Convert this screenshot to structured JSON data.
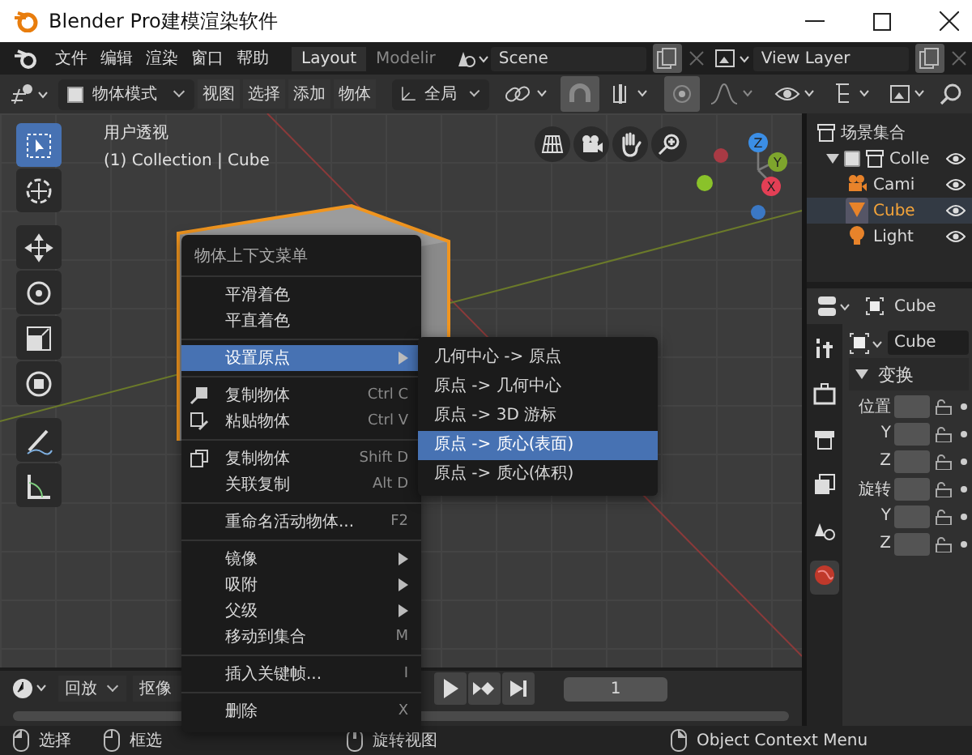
{
  "window": {
    "title": "Blender Pro建模渲染软件"
  },
  "menu_bar": [
    "文件",
    "编辑",
    "渲染",
    "窗口",
    "帮助"
  ],
  "workspaces": [
    {
      "label": "Layout",
      "selected": true
    },
    {
      "label": "Modelir",
      "selected": false
    }
  ],
  "scene": {
    "value": "Scene"
  },
  "view_layer": {
    "value": "View Layer"
  },
  "header": {
    "mode": "物体模式",
    "menus": [
      "视图",
      "选择",
      "添加",
      "物体"
    ],
    "orientation": "全局"
  },
  "viewport": {
    "view_name": "用户透视",
    "object_info": "(1) Collection | Cube",
    "gizmo_axes": [
      "Z",
      "Y",
      "X"
    ]
  },
  "tools": [
    {
      "kind": "select",
      "selected": true
    },
    {
      "kind": "cursor",
      "selected": false
    },
    {
      "kind": "move",
      "selected": false
    },
    {
      "kind": "rotate",
      "selected": false
    },
    {
      "kind": "scale",
      "selected": false
    },
    {
      "kind": "transform",
      "selected": false
    },
    {
      "kind": "annotate",
      "selected": false
    },
    {
      "kind": "measure",
      "selected": false
    }
  ],
  "context_menu": {
    "title": "物体上下文菜单",
    "sections": [
      [
        {
          "label": "平滑着色",
          "kind": "plain",
          "submenu": false,
          "selected": false
        },
        {
          "label": "平直着色",
          "kind": "plain",
          "submenu": false,
          "selected": false
        }
      ],
      [
        {
          "label": "设置原点",
          "kind": "plain",
          "submenu": true,
          "selected": true
        }
      ],
      [
        {
          "label": "复制物体",
          "kind": "copy",
          "shortcut": "Ctrl C",
          "submenu": false,
          "selected": false
        },
        {
          "label": "粘贴物体",
          "kind": "paste",
          "shortcut": "Ctrl V",
          "submenu": false,
          "selected": false
        }
      ],
      [
        {
          "label": "复制物体",
          "kind": "duplicate",
          "shortcut": "Shift D",
          "submenu": false,
          "selected": false
        },
        {
          "label": "关联复制",
          "kind": "plain",
          "shortcut": "Alt D",
          "submenu": false,
          "selected": false
        }
      ],
      [
        {
          "label": "重命名活动物体...",
          "kind": "plain",
          "shortcut": "F2",
          "submenu": false,
          "selected": false
        }
      ],
      [
        {
          "label": "镜像",
          "kind": "plain",
          "submenu": true,
          "selected": false
        },
        {
          "label": "吸附",
          "kind": "plain",
          "submenu": true,
          "selected": false
        },
        {
          "label": "父级",
          "kind": "plain",
          "submenu": true,
          "selected": false
        },
        {
          "label": "移动到集合",
          "kind": "plain",
          "shortcut": "M",
          "submenu": false,
          "selected": false
        }
      ],
      [
        {
          "label": "插入关键帧...",
          "kind": "plain",
          "shortcut": "I",
          "submenu": false,
          "selected": false
        }
      ],
      [
        {
          "label": "删除",
          "kind": "plain",
          "shortcut": "X",
          "submenu": false,
          "selected": false
        }
      ]
    ]
  },
  "submenu": {
    "items": [
      {
        "label": "几何中心 -> 原点",
        "selected": false
      },
      {
        "label": "原点 -> 几何中心",
        "selected": false
      },
      {
        "label": "原点 -> 3D 游标",
        "selected": false
      },
      {
        "label": "原点 -> 质心(表面)",
        "selected": true
      },
      {
        "label": "原点 -> 质心(体积)",
        "selected": false
      }
    ]
  },
  "outliner": {
    "title": "场景集合",
    "children": [
      {
        "label": "Colle",
        "kind": "collection",
        "checked": true,
        "selected": false,
        "children": [
          {
            "label": "Cami",
            "kind": "camera",
            "selected": false
          },
          {
            "label": "Cube",
            "kind": "mesh",
            "selected": true
          },
          {
            "label": "Light",
            "kind": "light",
            "selected": false
          }
        ]
      }
    ]
  },
  "properties": {
    "object": "Cube",
    "data_name": "Cube",
    "panel": {
      "title": "变换",
      "expanded": true,
      "rows": [
        {
          "label": "位置"
        },
        {
          "label": "Y"
        },
        {
          "label": "Z"
        },
        {
          "label": "旋转"
        },
        {
          "label": "Y"
        },
        {
          "label": "Z"
        }
      ]
    }
  },
  "timeline": {
    "menus": [
      "回放",
      "抠像"
    ],
    "frame": "1"
  },
  "status_bar": [
    {
      "kind": "left-click",
      "label": "选择"
    },
    {
      "kind": "drag",
      "label": "框选"
    },
    {
      "kind": "middle-click",
      "label": "旋转视图"
    },
    {
      "kind": "right-click",
      "label": "Object Context Menu"
    }
  ]
}
